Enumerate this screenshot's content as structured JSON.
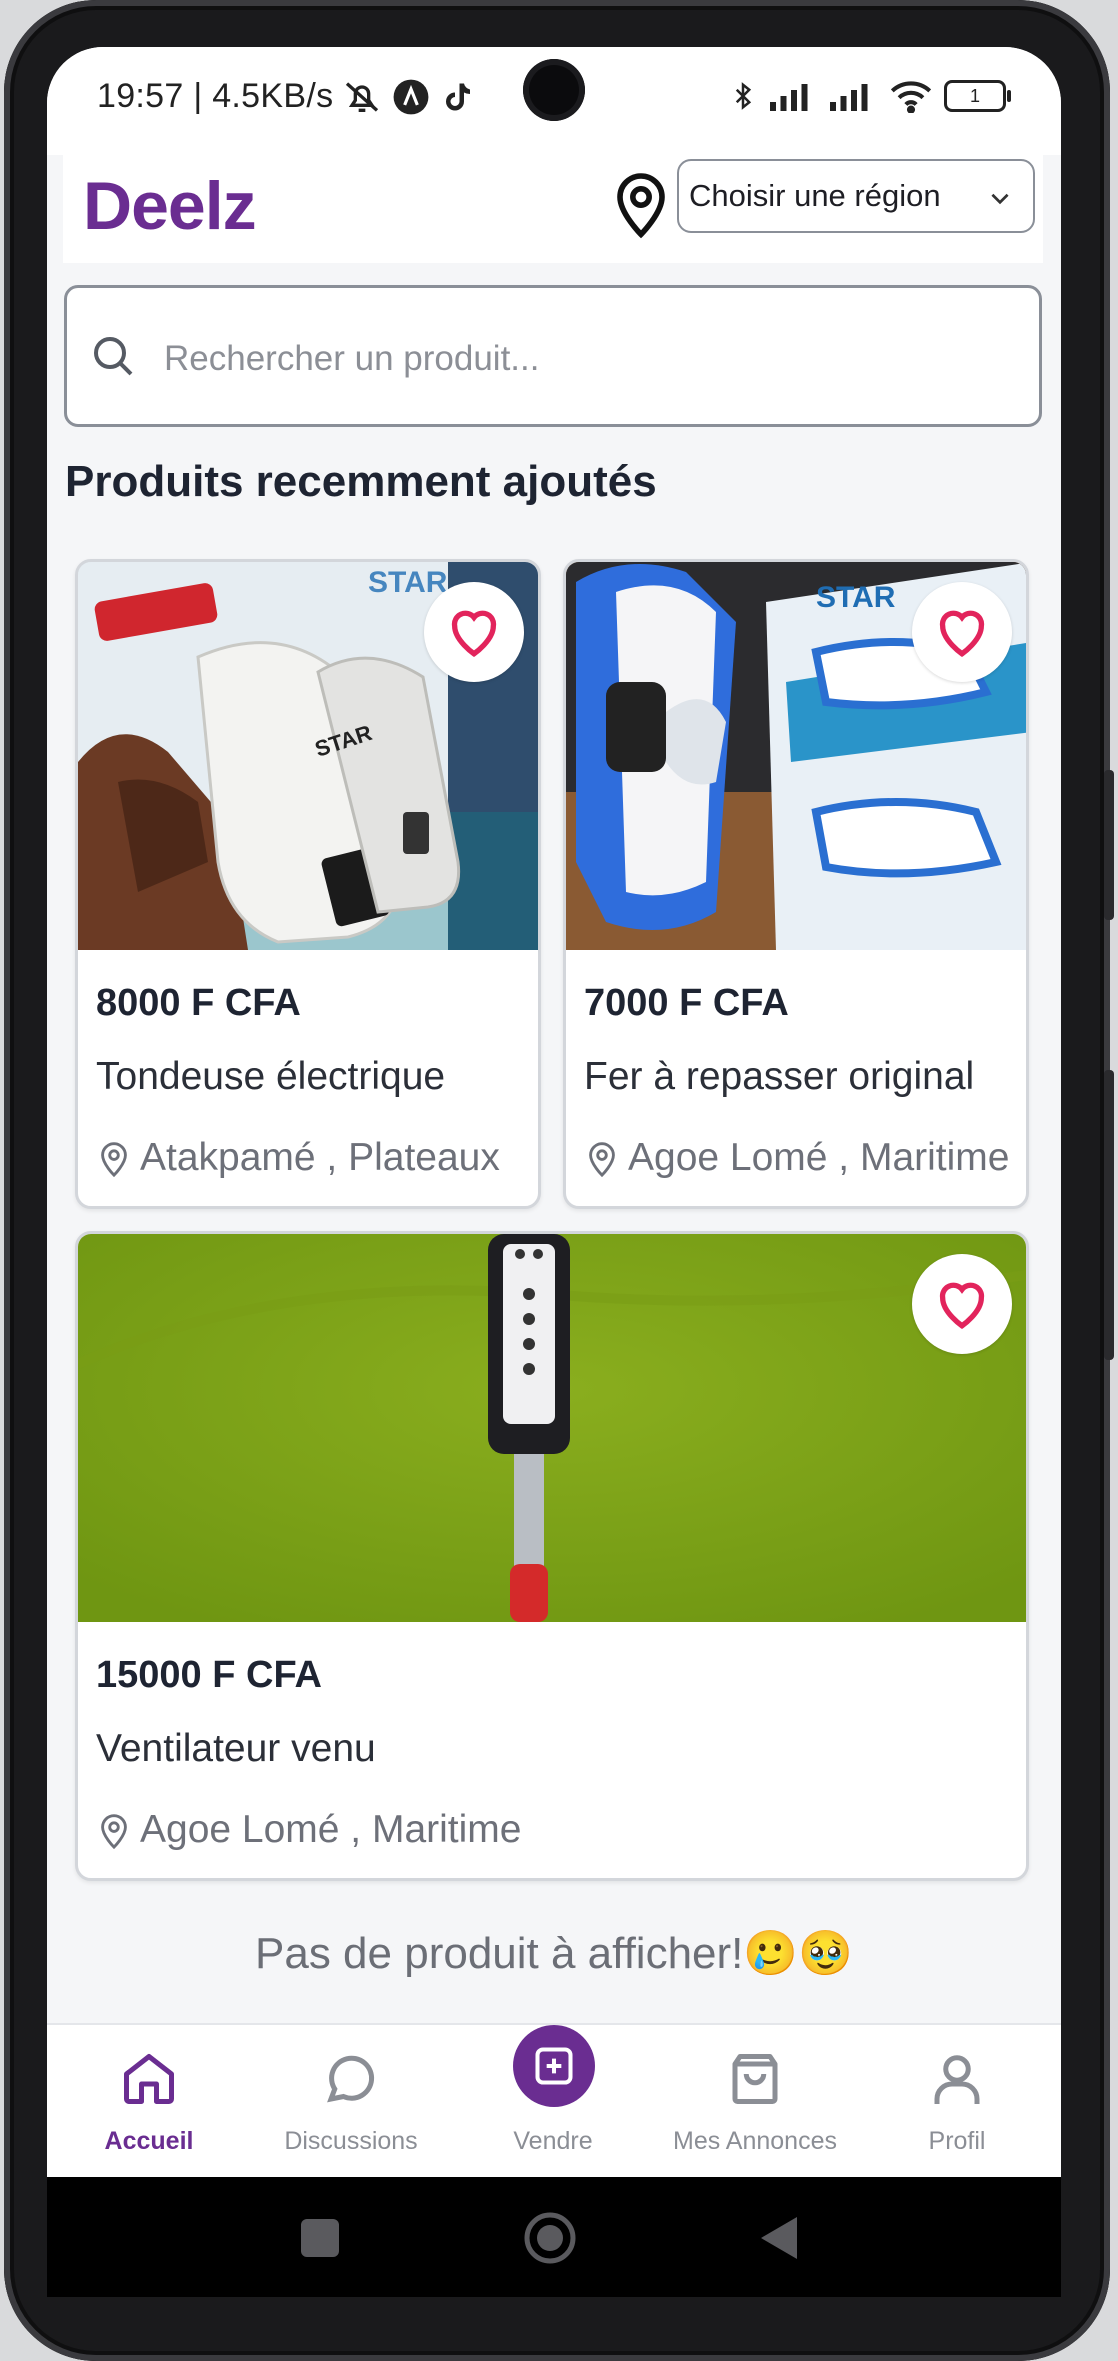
{
  "status_bar": {
    "time_speed": "19:57 | 4.5KB/s",
    "battery": "1"
  },
  "header": {
    "logo": "Deelz",
    "region_select": {
      "value": "Choisir une région"
    }
  },
  "search": {
    "placeholder": "Rechercher un produit..."
  },
  "section_title": "Produits recemment ajoutés",
  "products": [
    {
      "price": "8000 F CFA",
      "name": "Tondeuse électrique",
      "location": "Atakpamé , Plateaux"
    },
    {
      "price": "7000 F CFA",
      "name": "Fer à repasser original",
      "location": "Agoe Lomé , Maritime"
    },
    {
      "price": "15000 F CFA",
      "name": "Ventilateur venu",
      "location": "Agoe Lomé , Maritime"
    }
  ],
  "empty_message": "Pas de produit à afficher!🥲🥹",
  "bottom_nav": {
    "items": [
      {
        "label": "Accueil",
        "icon": "home-icon",
        "active": true
      },
      {
        "label": "Discussions",
        "icon": "chat-bubble-icon",
        "active": false
      },
      {
        "label": "Vendre",
        "icon": "plus-square-icon",
        "active": false
      },
      {
        "label": "Mes Annonces",
        "icon": "shopping-bag-icon",
        "active": false
      },
      {
        "label": "Profil",
        "icon": "user-icon",
        "active": false
      }
    ]
  },
  "colors": {
    "brand": "#6a2d91",
    "favorite": "#e2245c",
    "text_dark": "#1e2432",
    "text_muted": "#6d7079"
  }
}
